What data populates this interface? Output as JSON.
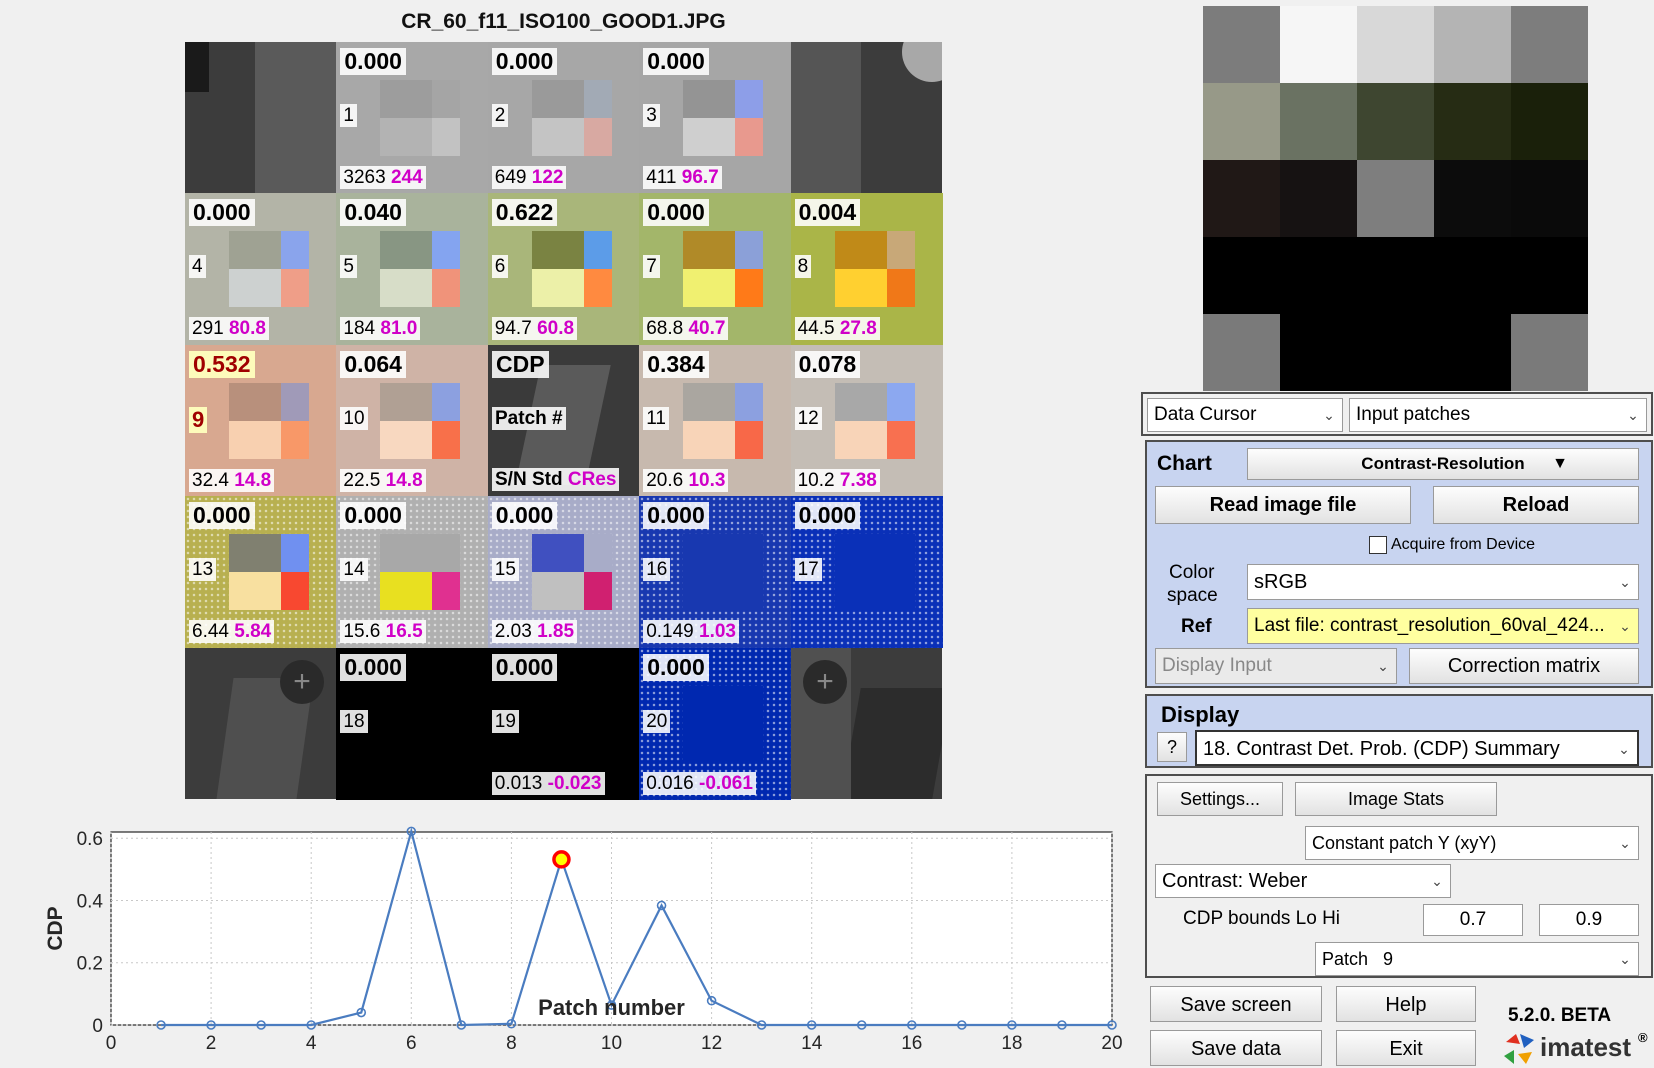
{
  "image_title": "CR_60_f11_ISO100_GOOD1.JPG",
  "cells": [
    {
      "n": "1",
      "cdp": "0.000",
      "sn": "3263",
      "cres": "244",
      "bg": "#a8a8a8",
      "m": [
        "#9d9d9d",
        "#a5a5a5",
        "#b3b3b3",
        "#c2c2c2"
      ],
      "pos": [
        0,
        1
      ]
    },
    {
      "n": "2",
      "cdp": "0.000",
      "sn": "649",
      "cres": "122",
      "bg": "#a7a7a7",
      "m": [
        "#9a9a9a",
        "#a2aab5",
        "#c4c4c4",
        "#d8a9a2"
      ],
      "pos": [
        0,
        2
      ]
    },
    {
      "n": "3",
      "cdp": "0.000",
      "sn": "411",
      "cres": "96.7",
      "bg": "#a6a6a6",
      "m": [
        "#949494",
        "#8d9ee8",
        "#cfcfcf",
        "#e8998e"
      ],
      "pos": [
        0,
        3
      ]
    },
    {
      "n": "4",
      "cdp": "0.000",
      "sn": "291",
      "cres": "80.8",
      "bg": "#b3b4a7",
      "m": [
        "#9fa293",
        "#8aa4ec",
        "#cdd1d0",
        "#ef9e88"
      ],
      "pos": [
        1,
        0
      ]
    },
    {
      "n": "5",
      "cdp": "0.040",
      "sn": "184",
      "cres": "81.0",
      "bg": "#a9b39c",
      "m": [
        "#889683",
        "#84a4f0",
        "#d7ddc8",
        "#f0937a"
      ],
      "pos": [
        1,
        1
      ]
    },
    {
      "n": "6",
      "cdp": "0.622",
      "sn": "94.7",
      "cres": "60.8",
      "bg": "#a9b67a",
      "m": [
        "#7a8342",
        "#5c9ce8",
        "#ecf0a8",
        "#ff8a40"
      ],
      "pos": [
        1,
        2
      ]
    },
    {
      "n": "7",
      "cdp": "0.000",
      "sn": "68.8",
      "cres": "40.7",
      "bg": "#a3b66a",
      "m": [
        "#b08a28",
        "#8ba0d8",
        "#f0f070",
        "#ff7a18"
      ],
      "pos": [
        1,
        3
      ]
    },
    {
      "n": "8",
      "cdp": "0.004",
      "sn": "44.5",
      "cres": "27.8",
      "bg": "#aab548",
      "m": [
        "#c08a18",
        "#c8a878",
        "#ffd030",
        "#f07818"
      ],
      "pos": [
        1,
        4
      ]
    },
    {
      "n": "9",
      "cdp": "0.532",
      "sn": "32.4",
      "cres": "14.8",
      "bg": "#d8a890",
      "m": [
        "#b8907c",
        "#a09ab8",
        "#f8d0b0",
        "#f89868"
      ],
      "pos": [
        2,
        0
      ],
      "hl": true
    },
    {
      "n": "10",
      "cdp": "0.064",
      "sn": "22.5",
      "cres": "14.8",
      "bg": "#cfb3a6",
      "m": [
        "#b0a094",
        "#8ca0e0",
        "#f8d8c0",
        "#f8704a"
      ],
      "pos": [
        2,
        1
      ]
    },
    {
      "n": "11",
      "cdp": "0.384",
      "sn": "20.6",
      "cres": "10.3",
      "bg": "#c7b9ae",
      "m": [
        "#aaa6a0",
        "#8ca0e0",
        "#f8d4b8",
        "#f86848"
      ],
      "pos": [
        2,
        3
      ]
    },
    {
      "n": "12",
      "cdp": "0.078",
      "sn": "10.2",
      "cres": "7.38",
      "bg": "#c4bdb5",
      "m": [
        "#a8a8a8",
        "#8ca8f0",
        "#f8d4b8",
        "#f87050"
      ],
      "pos": [
        2,
        4
      ]
    },
    {
      "n": "13",
      "cdp": "0.000",
      "sn": "6.44",
      "cres": "5.84",
      "bg": "#b8b050",
      "m": [
        "#808070",
        "#7090f0",
        "#f8e0a0",
        "#f84830"
      ],
      "pos": [
        3,
        0
      ]
    },
    {
      "n": "14",
      "cdp": "0.000",
      "sn": "15.6",
      "cres": "16.5",
      "bg": "#b0b0b0",
      "m": [
        "#a8a8a8",
        "#a8a8a8",
        "#e8e020",
        "#e03090"
      ],
      "pos": [
        3,
        1
      ]
    },
    {
      "n": "15",
      "cdp": "0.000",
      "sn": "2.03",
      "cres": "1.85",
      "bg": "#a8acc8",
      "m": [
        "#4050c0",
        "#a8acc8",
        "#c0c0c0",
        "#d02070"
      ],
      "pos": [
        3,
        2
      ]
    },
    {
      "n": "16",
      "cdp": "0.000",
      "sn": "0.149",
      "cres": "1.03",
      "bg": "#1838b0",
      "m": [
        "#1838b0",
        "#1838b0",
        "#1838b0",
        "#1838b0"
      ],
      "pos": [
        3,
        3
      ]
    },
    {
      "n": "17",
      "cdp": "0.000",
      "sn": "",
      "cres": "",
      "bg": "#0a30b8",
      "m": [
        "#0a30b8",
        "#0a30b8",
        "#0a30b8",
        "#0a30b8"
      ],
      "pos": [
        3,
        4
      ]
    },
    {
      "n": "18",
      "cdp": "0.000",
      "sn": "",
      "cres": "",
      "bg": "#000000",
      "m": [
        "#000",
        "#000",
        "#000",
        "#000"
      ],
      "pos": [
        4,
        1
      ]
    },
    {
      "n": "19",
      "cdp": "0.000",
      "sn": "0.013",
      "cres": "-0.023",
      "bg": "#000000",
      "m": [
        "#000",
        "#000",
        "#000",
        "#000"
      ],
      "pos": [
        4,
        2
      ]
    },
    {
      "n": "20",
      "cdp": "0.000",
      "sn": "0.016",
      "cres": "-0.061",
      "bg": "#0028b0",
      "m": [
        "#0028b0",
        "#0028b0",
        "#0028b0",
        "#0028b0"
      ],
      "pos": [
        4,
        3
      ]
    }
  ],
  "center_legend": {
    "cdp": "CDP",
    "patch": "Patch #",
    "sn": "S/N Std",
    "cres": "CRes"
  },
  "swatch_colors": [
    [
      "#7c7c7c",
      "#f6f6f6",
      "#d8d8d8",
      "#b4b4b4",
      "#7d7d7d"
    ],
    [
      "#979988",
      "#6a7262",
      "#3e4630",
      "#262c14",
      "#1a200a"
    ],
    [
      "#201816",
      "#161212",
      "#7e7e7e",
      "#0c0c0c",
      "#0a0a0a"
    ],
    [
      "#000000",
      "#000000",
      "#000000",
      "#000000",
      "#000000"
    ],
    [
      "#7a7a7a",
      "#000000",
      "#000000",
      "#000000",
      "#7a7a7a"
    ]
  ],
  "top_row": {
    "data_cursor": "Data Cursor",
    "input_patches": "Input patches"
  },
  "chart_panel": {
    "chart_label": "Chart",
    "chart_value": "Contrast-Resolution",
    "read_btn": "Read image file",
    "reload_btn": "Reload",
    "acquire": "Acquire from Device",
    "color_label_1": "Color",
    "color_label_2": "space",
    "color_value": "sRGB",
    "ref_label": "Ref",
    "ref_value": "Last file: contrast_resolution_60val_424...",
    "display_input": "Display Input",
    "correction_btn": "Correction matrix"
  },
  "display_panel": {
    "label": "Display",
    "q": "?",
    "value": "18. Contrast Det. Prob. (CDP) Summary"
  },
  "settings_panel": {
    "settings_btn": "Settings...",
    "stats_btn": "Image Stats",
    "constant": "Constant patch Y (xyY)",
    "contrast": "Contrast: Weber",
    "bounds_label": "CDP bounds Lo Hi",
    "lo": "0.7",
    "hi": "0.9",
    "patch_label": "Patch",
    "patch_value": "9"
  },
  "bottom": {
    "save_screen": "Save screen",
    "help": "Help",
    "save_data": "Save data",
    "exit": "Exit",
    "version": "5.2.0. BETA",
    "brand": "imatest"
  },
  "colors": {
    "line": "#4a7cc0",
    "marker_hl": "#ff0000",
    "marker_fill": "#ffff00",
    "panel": "#c8d4f0"
  },
  "chart_data": {
    "type": "line",
    "xlabel": "Patch number",
    "ylabel": "CDP",
    "xlim": [
      0,
      20
    ],
    "ylim": [
      0,
      0.62
    ],
    "xticks": [
      0,
      2,
      4,
      6,
      8,
      10,
      12,
      14,
      16,
      18,
      20
    ],
    "yticks": [
      0,
      0.2,
      0.4,
      0.6
    ],
    "ytick_labels": [
      "0",
      "0.2",
      "0.4",
      "0.6"
    ],
    "grid": true,
    "x": [
      1,
      2,
      3,
      4,
      5,
      6,
      7,
      8,
      9,
      10,
      11,
      12,
      13,
      14,
      15,
      16,
      17,
      18,
      19,
      20
    ],
    "y": [
      0,
      0,
      0,
      0,
      0.04,
      0.622,
      0,
      0.004,
      0.532,
      0.064,
      0.384,
      0.078,
      0,
      0,
      0,
      0,
      0,
      0,
      0,
      0
    ],
    "highlight_x": 9
  }
}
